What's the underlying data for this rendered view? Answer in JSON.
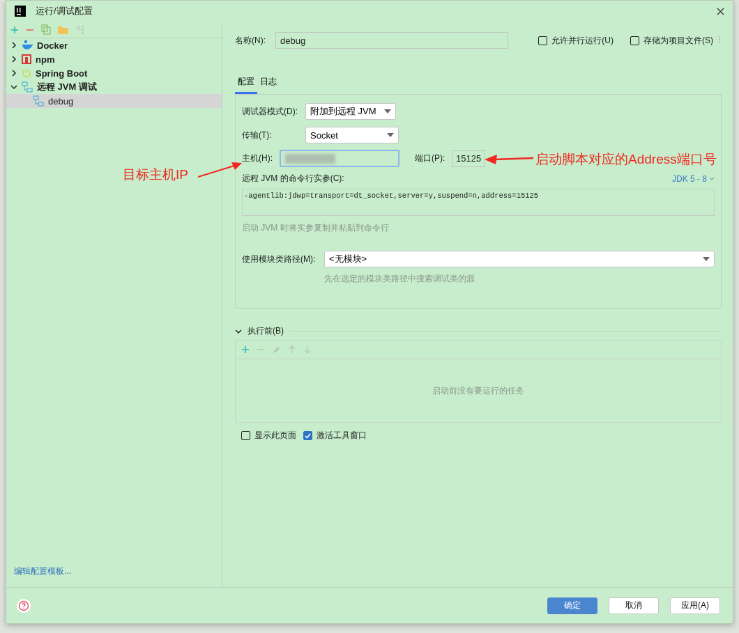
{
  "window": {
    "title": "运行/调试配置"
  },
  "sidebar": {
    "tree": [
      {
        "label": "Docker",
        "kind": "docker",
        "expanded": false,
        "selected": false
      },
      {
        "label": "npm",
        "kind": "npm",
        "expanded": false,
        "selected": false
      },
      {
        "label": "Spring Boot",
        "kind": "spring",
        "expanded": false,
        "selected": false
      },
      {
        "label": "远程 JVM 调试",
        "kind": "remote",
        "expanded": true,
        "selected": false,
        "children": [
          {
            "label": "debug",
            "kind": "remote",
            "selected": true
          }
        ]
      }
    ],
    "footer_link": "编辑配置模板..."
  },
  "header": {
    "name_label": "名称(N):",
    "name_value": "debug",
    "options": [
      {
        "label": "允许并行运行(U)",
        "checked": false
      },
      {
        "label": "存储为项目文件(S)",
        "checked": false
      }
    ]
  },
  "tabs": [
    {
      "label": "配置",
      "selected": true
    },
    {
      "label": "日志",
      "selected": false
    }
  ],
  "config": {
    "debugger_mode": {
      "label": "调试器模式(D):",
      "value": "附加到远程 JVM"
    },
    "transport": {
      "label": "传输(T):",
      "value": "Socket"
    },
    "host": {
      "label": "主机(H):"
    },
    "port": {
      "label": "端口(P):",
      "value": "15125"
    },
    "args_label": "远程 JVM 的命令行实参(C):",
    "jdk": "JDK 5 - 8",
    "args_value": "-agentlib:jdwp=transport=dt_socket,server=y,suspend=n,address=15125",
    "args_hint": "启动 JVM 时将实参复制并粘贴到命令行",
    "module": {
      "label": "使用模块类路径(M):",
      "value": "<无模块>",
      "hint": "先在选定的模块类路径中搜索调试类的源"
    }
  },
  "before_launch": {
    "title": "执行前(B)",
    "expanded": true,
    "empty_text": "启动前没有要运行的任务"
  },
  "options": [
    {
      "label": "显示此页面",
      "checked": false
    },
    {
      "label": "激活工具窗口",
      "checked": true
    }
  ],
  "buttons": [
    {
      "label": "确定",
      "kind": "primary"
    },
    {
      "label": "取消",
      "kind": "default"
    },
    {
      "label": "应用(A)",
      "kind": "default"
    }
  ],
  "annotations": [
    {
      "text": "目标主机IP",
      "kind": "left"
    },
    {
      "text": "启动脚本对应的Address端口号",
      "kind": "right"
    }
  ]
}
